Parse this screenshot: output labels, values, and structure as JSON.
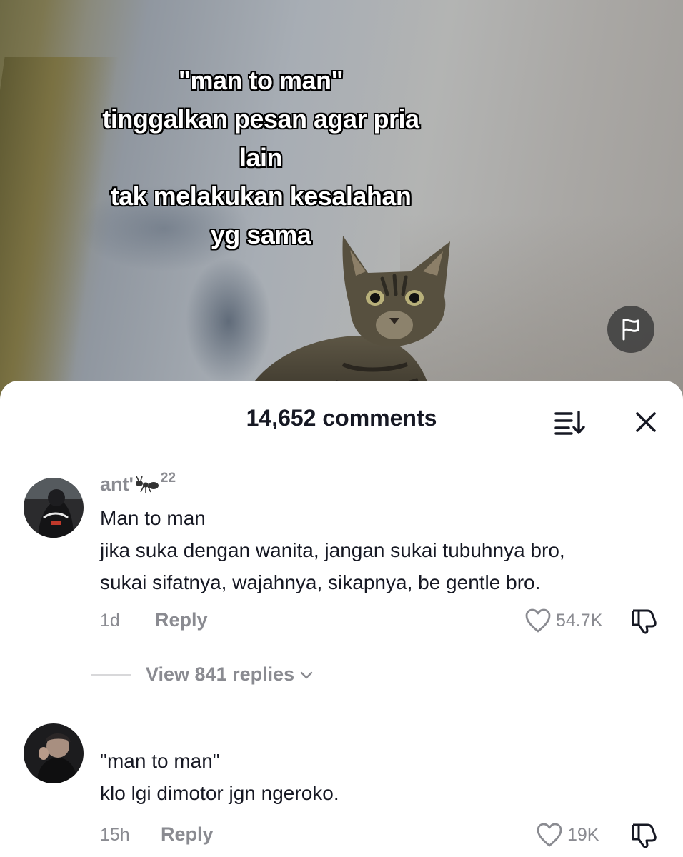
{
  "video": {
    "caption_lines": [
      "\"man to man\"",
      "tinggalkan pesan agar pria",
      "lain",
      "tak melakukan kesalahan",
      "yg sama"
    ]
  },
  "comments_panel": {
    "count_label": "14,652 comments",
    "icons": {
      "sort": "sort-icon",
      "close": "close-icon",
      "report": "flag-icon"
    },
    "comments": [
      {
        "username": "ant'",
        "username_badge": "ant-emoji",
        "username_suffix": "22",
        "text_lines": [
          "Man to man",
          "jika suka dengan wanita, jangan sukai tubuhnya bro,",
          "sukai sifatnya, wajahnya, sikapnya, be gentle bro."
        ],
        "time": "1d",
        "reply_label": "Reply",
        "likes": "54.7K",
        "view_replies_label": "View 841 replies"
      },
      {
        "username": "",
        "text_lines": [
          "\"man to man\"",
          "klo lgi dimotor jgn ngeroko."
        ],
        "time": "15h",
        "reply_label": "Reply",
        "likes": "19K"
      }
    ]
  }
}
